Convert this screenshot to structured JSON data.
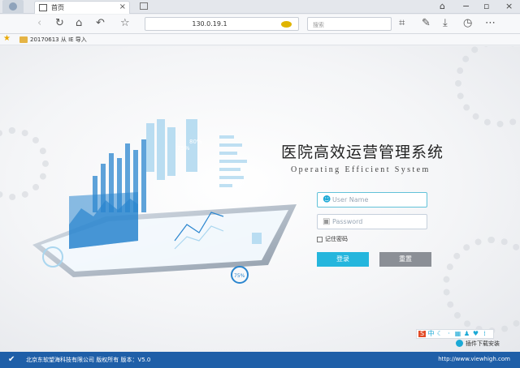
{
  "colors": {
    "accent": "#25b6dd",
    "reset_button": "#8b8f96",
    "footer_bg": "#1f5fa8",
    "chart_blue": "#2b86cf",
    "chart_light": "#aad6ef"
  },
  "browser": {
    "tab": {
      "title": "首页",
      "close": "×"
    },
    "window_controls": [
      "⌂",
      "−",
      "▫",
      "×"
    ],
    "address": "130.0.19.1",
    "search_placeholder": "搜索",
    "bookmark": {
      "label": "20170613 从 IE 导入"
    },
    "icons": [
      "back-icon",
      "reload-icon",
      "home-icon",
      "undo-icon",
      "star-icon",
      "crop-icon",
      "download-icon",
      "history-icon",
      "menu-icon"
    ]
  },
  "login": {
    "title_cn": "医院高效运营管理系统",
    "title_en": "Operating Efficient System",
    "username_placeholder": "User Name",
    "password_placeholder": "Password",
    "remember_label": "记住密码",
    "login_button": "登录",
    "reset_button": "重置"
  },
  "illustration": {
    "badge_value_1": "75%",
    "badge_value_2": "80%",
    "badge_value_3": "75%"
  },
  "ime": {
    "mode": "中"
  },
  "plugin": {
    "label": "插件下载安装"
  },
  "footer": {
    "copyright": "北京东软望海科技有限公司 版权所有 版本：V5.0",
    "url": "http://www.viewhigh.com"
  }
}
